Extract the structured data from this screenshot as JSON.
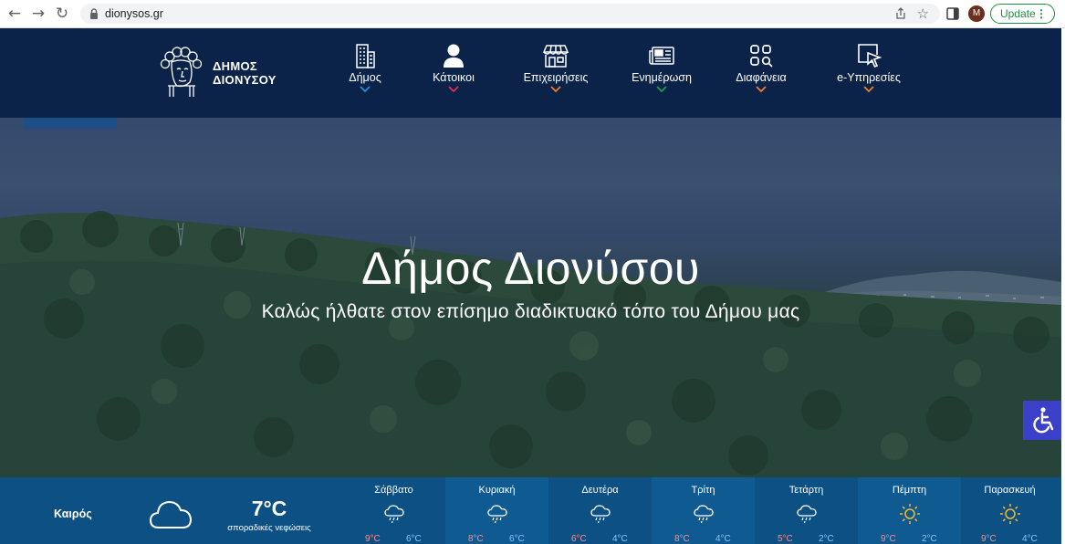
{
  "browser": {
    "url": "dionysos.gr",
    "profile_initial": "M",
    "update_label": "Update"
  },
  "site": {
    "logo_line1": "ΔΗΜΟΣ",
    "logo_line2": "ΔΙΟΝΥΣΟΥ",
    "menu": [
      {
        "label": "Δήμος",
        "icon": "building-icon",
        "accent": "#2f8fd8"
      },
      {
        "label": "Κάτοικοι",
        "icon": "person-icon",
        "accent": "#e0344c"
      },
      {
        "label": "Επιχειρήσεις",
        "icon": "storefront-icon",
        "accent": "#f07c2a"
      },
      {
        "label": "Ενημέρωση",
        "icon": "newspaper-icon",
        "accent": "#1f9a52"
      },
      {
        "label": "Διαφάνεια",
        "icon": "apps-search-icon",
        "accent": "#f07c2a"
      },
      {
        "label": "e-Υπηρεσίες",
        "icon": "cursor-window-icon",
        "accent": "#f07c2a"
      }
    ]
  },
  "hero": {
    "title": "Δήμος Διονύσου",
    "subtitle": "Καλώς ήλθατε στον επίσημο διαδικτυακό τόπο του Δήμου μας"
  },
  "weather": {
    "label": "Καιρός",
    "current_icon": "cloud-icon",
    "current_temp": "7°C",
    "current_desc": "σποραδικές νεφώσεις",
    "days": [
      {
        "name": "Σάββατο",
        "icon": "rain-cloud-icon",
        "max": "9°C",
        "min": "6°C"
      },
      {
        "name": "Κυριακή",
        "icon": "rain-cloud-icon",
        "max": "8°C",
        "min": "6°C"
      },
      {
        "name": "Δευτέρα",
        "icon": "rain-cloud-icon",
        "max": "6°C",
        "min": "4°C"
      },
      {
        "name": "Τρίτη",
        "icon": "rain-cloud-icon",
        "max": "8°C",
        "min": "4°C"
      },
      {
        "name": "Τετάρτη",
        "icon": "rain-cloud-icon",
        "max": "5°C",
        "min": "2°C"
      },
      {
        "name": "Πέμπτη",
        "icon": "sun-icon",
        "max": "9°C",
        "min": "2°C"
      },
      {
        "name": "Παρασκευή",
        "icon": "sun-icon",
        "max": "9°C",
        "min": "4°C"
      }
    ]
  },
  "accessibility": {
    "icon": "wheelchair-icon",
    "color": "#3b40c9"
  }
}
